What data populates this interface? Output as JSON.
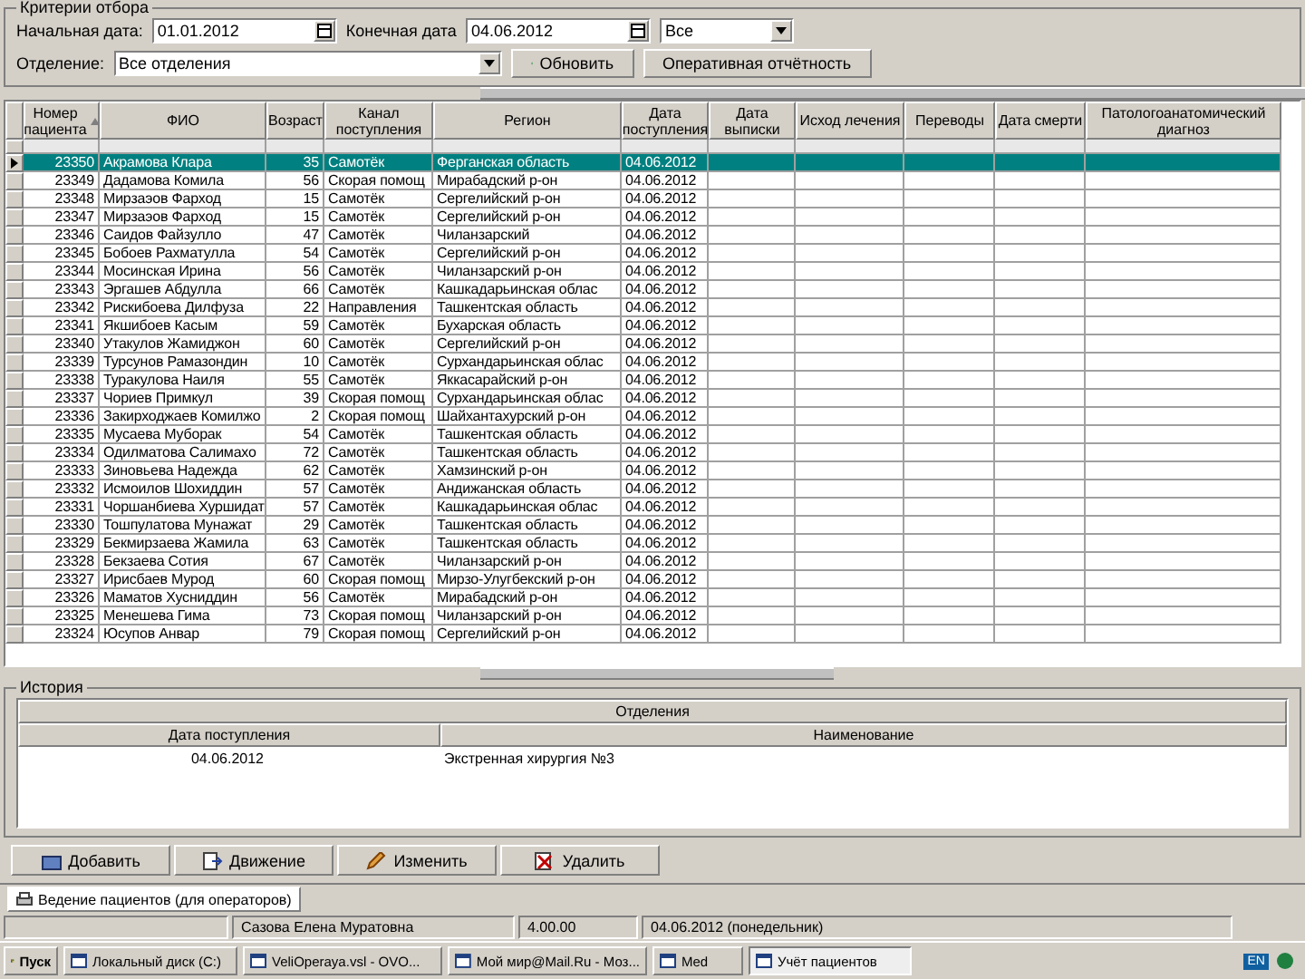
{
  "filter": {
    "title": "Критерии отбора",
    "start_label": "Начальная дата:",
    "start_date": "01.01.2012",
    "end_label": "Конечная дата",
    "end_date": "04.06.2012",
    "scope": "Все",
    "department_label": "Отделение:",
    "department": "Все отделения",
    "refresh": "Обновить",
    "report": "Оперативная отчётность"
  },
  "patients": {
    "columns": [
      {
        "label": "Номер пациента",
        "sorted": true
      },
      {
        "label": "ФИО",
        "sorted": false
      },
      {
        "label": "Возраст",
        "sorted": false
      },
      {
        "label": "Канал поступления",
        "sorted": false
      },
      {
        "label": "Регион",
        "sorted": false
      },
      {
        "label": "Дата поступления",
        "sorted": false
      },
      {
        "label": "Дата выписки",
        "sorted": false
      },
      {
        "label": "Исход лечения",
        "sorted": false
      },
      {
        "label": "Переводы",
        "sorted": false
      },
      {
        "label": "Дата смерти",
        "sorted": false
      },
      {
        "label": "Патологоанатомический диагноз",
        "sorted": false
      }
    ],
    "rows": [
      {
        "selected": true,
        "cells": [
          "23350",
          "Акрамова Клара",
          "35",
          "Самотёк",
          "Ферганская область",
          "04.06.2012"
        ]
      },
      {
        "selected": false,
        "cells": [
          "23349",
          "Дадамова Комила",
          "56",
          "Скорая помощ",
          "Мирабадский р-он",
          "04.06.2012"
        ]
      },
      {
        "selected": false,
        "cells": [
          "23348",
          "Мирзаэов Фарход",
          "15",
          "Самотёк",
          "Сергелийский р-он",
          "04.06.2012"
        ]
      },
      {
        "selected": false,
        "cells": [
          "23347",
          "Мирзаэов Фарход",
          "15",
          "Самотёк",
          "Сергелийский р-он",
          "04.06.2012"
        ]
      },
      {
        "selected": false,
        "cells": [
          "23346",
          "Саидов Файзулло",
          "47",
          "Самотёк",
          "Чиланзарский",
          "04.06.2012"
        ]
      },
      {
        "selected": false,
        "cells": [
          "23345",
          "Бобоев Рахматулла",
          "54",
          "Самотёк",
          "Сергелийский р-он",
          "04.06.2012"
        ]
      },
      {
        "selected": false,
        "cells": [
          "23344",
          "Мосинская Ирина",
          "56",
          "Самотёк",
          "Чиланзарский р-он",
          "04.06.2012"
        ]
      },
      {
        "selected": false,
        "cells": [
          "23343",
          "Эргашев Абдулла",
          "66",
          "Самотёк",
          "Кашкадарьинская облас",
          "04.06.2012"
        ]
      },
      {
        "selected": false,
        "cells": [
          "23342",
          "Рискибоева Дилфуза",
          "22",
          "Направления",
          "Ташкентская область",
          "04.06.2012"
        ]
      },
      {
        "selected": false,
        "cells": [
          "23341",
          "Якшибоев Касым",
          "59",
          "Самотёк",
          "Бухарская область",
          "04.06.2012"
        ]
      },
      {
        "selected": false,
        "cells": [
          "23340",
          "Утакулов Жамиджон",
          "60",
          "Самотёк",
          "Сергелийский р-он",
          "04.06.2012"
        ]
      },
      {
        "selected": false,
        "cells": [
          "23339",
          "Турсунов Рамазондин",
          "10",
          "Самотёк",
          "Сурхандарьинская облас",
          "04.06.2012"
        ]
      },
      {
        "selected": false,
        "cells": [
          "23338",
          "Туракулова Наиля",
          "55",
          "Самотёк",
          "Яккасарайский р-он",
          "04.06.2012"
        ]
      },
      {
        "selected": false,
        "cells": [
          "23337",
          "Чориев Примкул",
          "39",
          "Скорая помощ",
          "Сурхандарьинская облас",
          "04.06.2012"
        ]
      },
      {
        "selected": false,
        "cells": [
          "23336",
          "Закирходжаев Комилжо",
          "2",
          "Скорая помощ",
          "Шайхантахурский р-он",
          "04.06.2012"
        ]
      },
      {
        "selected": false,
        "cells": [
          "23335",
          "Мусаева Муборак",
          "54",
          "Самотёк",
          "Ташкентская область",
          "04.06.2012"
        ]
      },
      {
        "selected": false,
        "cells": [
          "23334",
          "Одилматова Салимахо",
          "72",
          "Самотёк",
          "Ташкентская область",
          "04.06.2012"
        ]
      },
      {
        "selected": false,
        "cells": [
          "23333",
          "Зиновьева Надежда",
          "62",
          "Самотёк",
          "Хамзинский р-он",
          "04.06.2012"
        ]
      },
      {
        "selected": false,
        "cells": [
          "23332",
          "Исмоилов Шохиддин",
          "57",
          "Самотёк",
          "Андижанская область",
          "04.06.2012"
        ]
      },
      {
        "selected": false,
        "cells": [
          "23331",
          "Чоршанбиева Хуршидат",
          "57",
          "Самотёк",
          "Кашкадарьинская облас",
          "04.06.2012"
        ]
      },
      {
        "selected": false,
        "cells": [
          "23330",
          "Тошпулатова Мунажат",
          "29",
          "Самотёк",
          "Ташкентская область",
          "04.06.2012"
        ]
      },
      {
        "selected": false,
        "cells": [
          "23329",
          "Бекмирзаева Жамила",
          "63",
          "Самотёк",
          "Ташкентская область",
          "04.06.2012"
        ]
      },
      {
        "selected": false,
        "cells": [
          "23328",
          "Бекзаева Сотия",
          "67",
          "Самотёк",
          "Чиланзарский р-он",
          "04.06.2012"
        ]
      },
      {
        "selected": false,
        "cells": [
          "23327",
          "Ирисбаев Мурод",
          "60",
          "Скорая помощ",
          "Мирзо-Улугбекский р-он",
          "04.06.2012"
        ]
      },
      {
        "selected": false,
        "cells": [
          "23326",
          "Маматов Хусниддин",
          "56",
          "Самотёк",
          "Мирабадский р-он",
          "04.06.2012"
        ]
      },
      {
        "selected": false,
        "cells": [
          "23325",
          "Менешева Гима",
          "73",
          "Скорая помощ",
          "Чиланзарский р-он",
          "04.06.2012"
        ]
      },
      {
        "selected": false,
        "cells": [
          "23324",
          "Юсупов Анвар",
          "79",
          "Скорая помощ",
          "Сергелийский р-он",
          "04.06.2012"
        ]
      }
    ]
  },
  "history": {
    "title": "История",
    "group": "Отделения",
    "columns": [
      "Дата поступления",
      "Наименование"
    ],
    "rows": [
      [
        "04.06.2012",
        "Экстренная хирургия №3"
      ]
    ]
  },
  "actions": [
    {
      "kind": "add",
      "label": "Добавить"
    },
    {
      "kind": "move",
      "label": "Движение"
    },
    {
      "kind": "edit",
      "label": "Изменить"
    },
    {
      "kind": "delete",
      "label": "Удалить"
    }
  ],
  "tabs": [
    {
      "label": "Ведение пациентов (для операторов)",
      "selected": true
    }
  ],
  "status_bar": [
    "Сазова Елена Муратовна",
    "4.00.00",
    "04.06.2012 (понедельник)"
  ],
  "taskbar": {
    "start": "Пуск",
    "items": [
      {
        "label": "Локальный диск (C:)",
        "selected": false
      },
      {
        "label": "VeliOperaya.vsl - OVO...",
        "selected": false
      },
      {
        "label": "Мой мир@Mail.Ru - Моз...",
        "selected": false
      },
      {
        "label": "Med",
        "selected": false
      },
      {
        "label": "Учёт пациентов",
        "selected": true
      }
    ],
    "language": "EN"
  }
}
